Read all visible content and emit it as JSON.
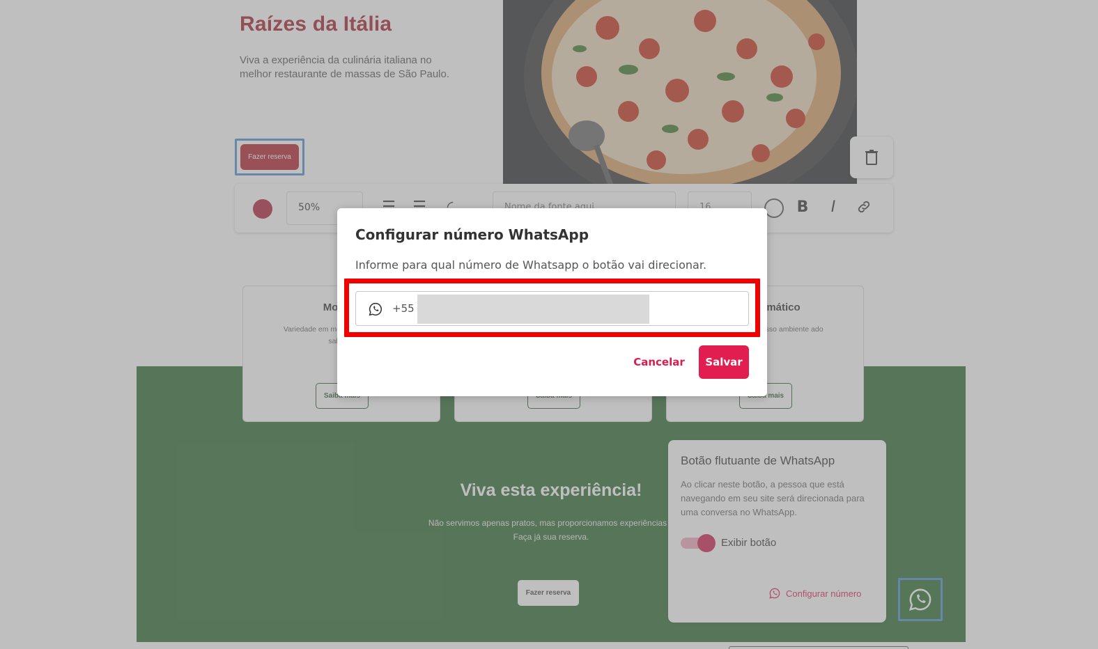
{
  "hero": {
    "title": "Raízes da Itália",
    "subtitle": "Viva a experiência da culinária italiana no melhor restaurante de massas de São Paulo.",
    "reserve_button": "Fazer reserva"
  },
  "toolbar": {
    "color": "#b0213e",
    "opacity": "50%",
    "font_placeholder": "Nome da fonte aqui",
    "font_size": "16"
  },
  "cards": [
    {
      "title": "Molhos",
      "desc": "Variedade em molhos com diversos sabores",
      "button": "Saiba mais"
    },
    {
      "title": "",
      "desc": "",
      "button": "Saiba mais"
    },
    {
      "title": "temático",
      "desc": "nosso ambiente ado",
      "button": "Saiba mais"
    }
  ],
  "green_section": {
    "title": "Viva esta experiência!",
    "text_line1": "Não servimos apenas pratos, mas proporcionamos experiências ú",
    "text_line2": "Faça já sua reserva.",
    "button": "Fazer reserva",
    "bg_color": "#2f6b33"
  },
  "whatsapp_panel": {
    "title": "Botão flutuante de WhatsApp",
    "description": "Ao clicar neste botão, a pessoa que está navegando em seu site será direcionada para uma conversa no WhatsApp.",
    "toggle_label": "Exibir botão",
    "toggle_on": true,
    "config_link": "Configurar número"
  },
  "modal": {
    "title": "Configurar número WhatsApp",
    "description": "Informe para qual número de Whatsapp o botão vai direcionar.",
    "country_code": "+55",
    "phone_value": "",
    "phone_placeholder": "",
    "cancel_label": "Cancelar",
    "save_label": "Salvar",
    "accent_color": "#e21d50",
    "highlight_color": "#f00000"
  }
}
